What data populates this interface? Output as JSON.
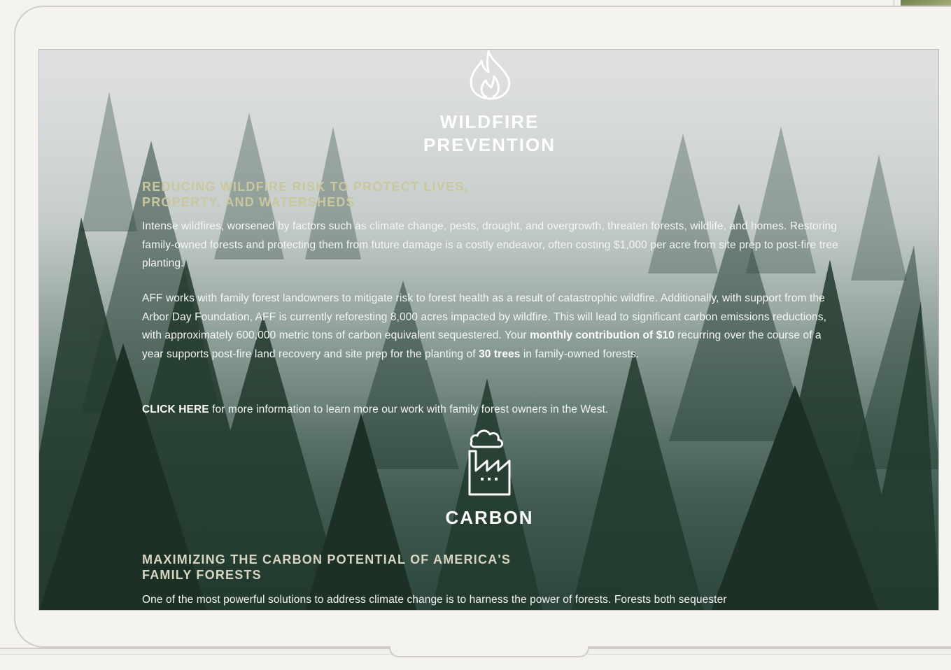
{
  "wildfire": {
    "title_line1": "WILDFIRE",
    "title_line2": "PREVENTION",
    "icon": "flame-icon",
    "subhead_line1": "REDUCING WILDFIRE RISK TO PROTECT LIVES,",
    "subhead_line2": "PROPERTY, AND WATERSHEDS",
    "para1": "Intense wildfires, worsened by factors such as climate change, pests, drought, and overgrowth, threaten forests, wildlife, and homes. Restoring family-owned forests and protecting them from future damage is a costly endeavor, often costing $1,000 per acre from site prep to post-fire tree planting.",
    "para2_a": "AFF works with family forest landowners to mitigate risk to forest health as a result of catastrophic wildfire. Additionally, with support from the Arbor Day Foundation, AFF is currently reforesting 8,000 acres impacted by wildfire. This will lead to significant carbon emissions reductions, with approximately 600,000 metric tons of carbon equivalent sequestered. Your ",
    "para2_bold1": "monthly contribution of $10",
    "para2_b": " recurring over the course of a year supports post-fire land recovery and site prep for the planting of ",
    "para2_bold2": "30 trees",
    "para2_c": " in family-owned forests.",
    "click_here": "CLICK HERE",
    "click_rest": " for more information to learn more our work with family forest owners in the West."
  },
  "carbon": {
    "title": "CARBON",
    "icon": "factory-cloud-icon",
    "subhead_line1": "MAXIMIZING THE CARBON POTENTIAL OF AMERICA'S",
    "subhead_line2": "FAMILY FORESTS",
    "para1": "One of the most powerful solutions to address climate change is to harness the power of forests. Forests both sequester"
  },
  "colors": {
    "subhead_wildfire": "#c9c79e",
    "subhead_carbon": "#d7d6c3",
    "frame": "#cfcdc6"
  }
}
